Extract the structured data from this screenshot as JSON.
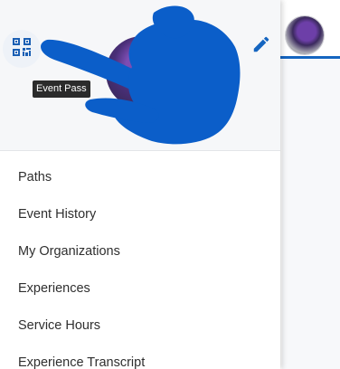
{
  "header": {
    "qr_icon": "qr-code-icon",
    "tooltip": "Event Pass",
    "edit_icon": "pencil-icon"
  },
  "menu": {
    "items": [
      {
        "label": "Paths"
      },
      {
        "label": "Event History"
      },
      {
        "label": "My Organizations"
      },
      {
        "label": "Experiences"
      },
      {
        "label": "Service Hours"
      },
      {
        "label": "Experience Transcript"
      }
    ]
  },
  "colors": {
    "accent": "#1565c0",
    "redaction": "#0b5ec9",
    "notification": "#e53935"
  }
}
